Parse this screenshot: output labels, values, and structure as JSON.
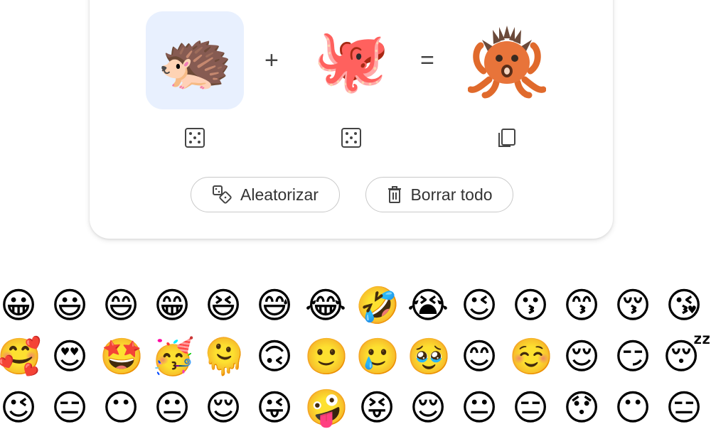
{
  "mixer": {
    "left_emoji": "🦔",
    "operator_plus": "+",
    "right_emoji": "🐙",
    "operator_equals": "=",
    "result_emoji": "🦔"
  },
  "actions": {
    "randomize_label": "Aleatorizar",
    "clear_label": "Borrar todo"
  },
  "icons": {
    "left_random": "dice-icon",
    "right_random": "dice-icon",
    "copy": "copy-icon",
    "randomize": "shapes-dice-icon",
    "clear": "trash-icon"
  },
  "emoji_grid": {
    "row1": [
      "😀",
      "😃",
      "😄",
      "😁",
      "😆",
      "😅",
      "😂",
      "🤣",
      "😭",
      "😉",
      "😗",
      "😙",
      "😚",
      "😘"
    ],
    "row2": [
      "🥰",
      "😍",
      "🤩",
      "🥳",
      "🫠",
      "🙃",
      "🙂",
      "🥲",
      "🥹",
      "😊",
      "☺️",
      "😌",
      "😏",
      "😴"
    ],
    "row3": [
      "😉",
      "😑",
      "😶",
      "😐",
      "😌",
      "😜",
      "🤪",
      "😝",
      "😌",
      "😐",
      "😑",
      "😯",
      "😶",
      "😑"
    ]
  }
}
